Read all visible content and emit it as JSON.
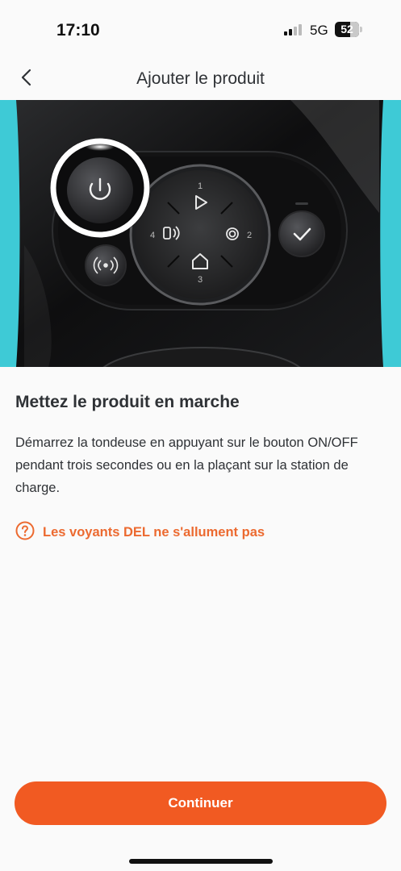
{
  "status_bar": {
    "time": "17:10",
    "network": "5G",
    "battery": "52"
  },
  "nav": {
    "title": "Ajouter le produit",
    "back_icon": "chevron-left-icon"
  },
  "hero": {
    "description_icons": [
      "power-icon",
      "play-icon",
      "spiral-icon",
      "home-icon",
      "phone-connect-icon",
      "radio-signal-icon",
      "check-icon"
    ],
    "labels": {
      "top": "1",
      "right": "2",
      "bottom": "3",
      "left": "4"
    }
  },
  "content": {
    "title": "Mettez le produit en marche",
    "body": "Démarrez la tondeuse en appuyant sur le bouton ON/OFF pendant trois secondes ou en la plaçant sur la station de charge.",
    "help_link": "Les voyants DEL ne s'allument pas",
    "help_icon": "question-circle-icon"
  },
  "footer": {
    "continue_label": "Continuer"
  },
  "colors": {
    "accent": "#f15a22",
    "link": "#ec6a30",
    "teal": "#3ecad6",
    "text": "#2f3236"
  }
}
